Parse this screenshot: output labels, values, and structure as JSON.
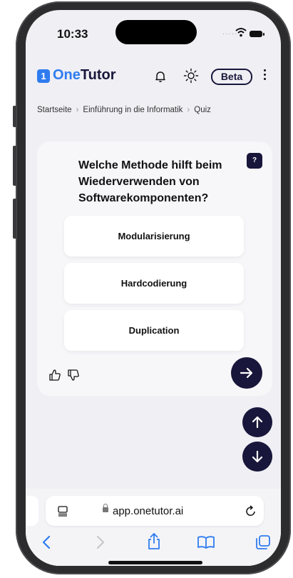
{
  "status": {
    "time": "10:33"
  },
  "app": {
    "logo_letter": "1",
    "brand_part1": "One",
    "brand_part2": "Tutor",
    "beta": "Beta",
    "accent": "#2f7cf0",
    "dark": "#18163a"
  },
  "breadcrumb": {
    "items": [
      "Startseite",
      "Einführung in die Informatik",
      "Quiz"
    ]
  },
  "quiz": {
    "help_label": "?",
    "question": "Welche Methode hilft beim Wiederverwenden von Softwarekomponenten?",
    "options": [
      "Modularisierung",
      "Hardcodierung",
      "Duplication"
    ]
  },
  "browser": {
    "url": "app.onetutor.ai"
  },
  "icons": [
    "bell-icon",
    "sun-icon",
    "more-icon",
    "thumbs-up-icon",
    "thumbs-down-icon",
    "arrow-right-icon",
    "arrow-up-icon",
    "arrow-down-icon",
    "tab-icon",
    "lock-icon",
    "reload-icon",
    "back-icon",
    "forward-icon",
    "share-icon",
    "bookmarks-icon",
    "tabs-icon"
  ]
}
